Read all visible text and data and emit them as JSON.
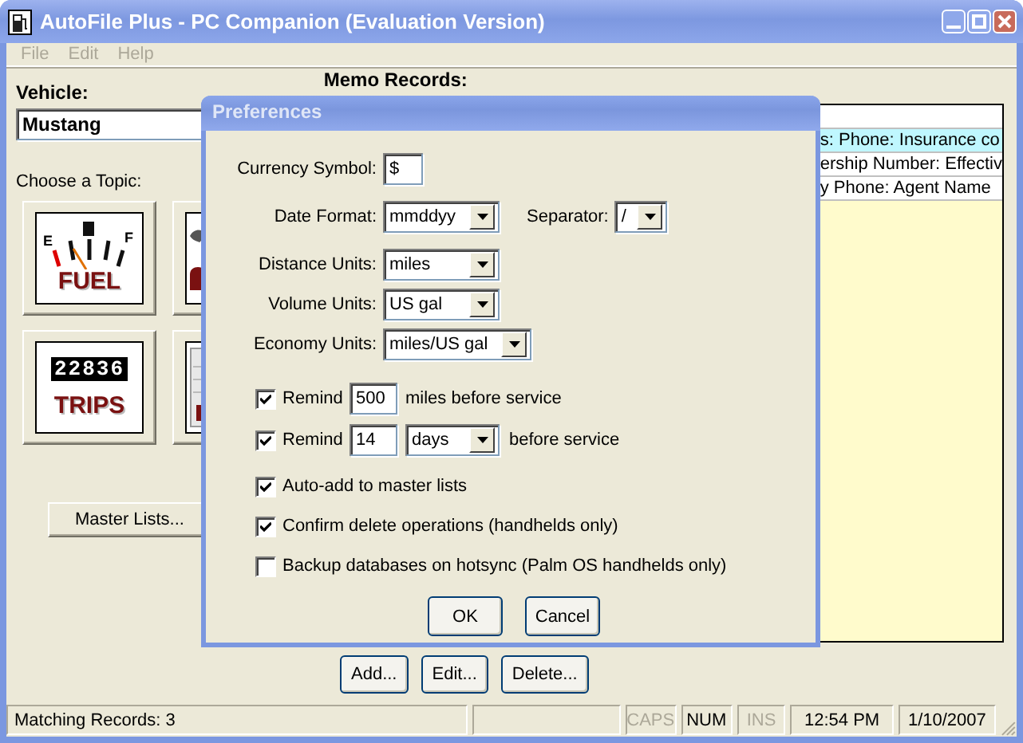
{
  "window": {
    "title": "AutoFile Plus - PC Companion (Evaluation Version)"
  },
  "menu": [
    {
      "label": "File",
      "disabled": true
    },
    {
      "label": "Edit",
      "disabled": true
    },
    {
      "label": "Help",
      "disabled": true
    }
  ],
  "vehicle": {
    "label": "Vehicle:",
    "value": "Mustang"
  },
  "topics": {
    "label": "Choose a Topic:",
    "buttons": [
      {
        "kind": "fuel",
        "label": "FUEL",
        "gauge_labels": [
          "E",
          "F"
        ]
      },
      {
        "kind": "service"
      },
      {
        "kind": "trips",
        "label": "TRIPS",
        "odometer": "22836"
      },
      {
        "kind": "notes"
      }
    ]
  },
  "master_lists_button": "Master Lists...",
  "memo": {
    "label": "Memo Records:",
    "header_lines": [
      {
        "text": "s:  Phone:  Insurance co",
        "highlighted": true
      },
      {
        "text": "ership Number:   Effectiv",
        "highlighted": false
      },
      {
        "text": "y Phone:   Agent Name",
        "highlighted": false
      }
    ]
  },
  "buttons": [
    "Add...",
    "Edit...",
    "Delete..."
  ],
  "status_bar": [
    {
      "kind": "text",
      "text": "Matching Records: 3"
    },
    {
      "kind": "blank"
    },
    {
      "kind": "key",
      "text": "CAPS",
      "active": false
    },
    {
      "kind": "key",
      "text": "NUM",
      "active": true
    },
    {
      "kind": "key",
      "text": "INS",
      "active": false
    },
    {
      "kind": "text",
      "text": "12:54 PM"
    },
    {
      "kind": "text",
      "text": "1/10/2007"
    }
  ],
  "dialog": {
    "title": "Preferences",
    "fields": [
      {
        "kind": "text",
        "label": "Currency Symbol:",
        "value": "$"
      },
      {
        "kind": "combo",
        "label": "Date Format:",
        "value": "mmddyy",
        "extra": {
          "label": "Separator:",
          "value": "/"
        }
      },
      {
        "kind": "combo",
        "label": "Distance Units:",
        "value": "miles"
      },
      {
        "kind": "combo",
        "label": "Volume Units:",
        "value": "US gal"
      },
      {
        "kind": "combo",
        "label": "Economy Units:",
        "value": "miles/US gal",
        "wide": true
      }
    ],
    "reminders": [
      {
        "checked": true,
        "label": "Remind",
        "value": "500",
        "suffix": "miles before service"
      },
      {
        "checked": true,
        "label": "Remind",
        "value": "14",
        "unit": "days",
        "suffix": "before service"
      }
    ],
    "options": [
      {
        "label": "Auto-add to master lists",
        "checked": true
      },
      {
        "label": "Confirm delete operations (handhelds only)",
        "checked": true
      },
      {
        "label": "Backup databases on hotsync (Palm OS handhelds only)",
        "checked": false
      }
    ],
    "buttons": [
      "OK",
      "Cancel"
    ]
  }
}
